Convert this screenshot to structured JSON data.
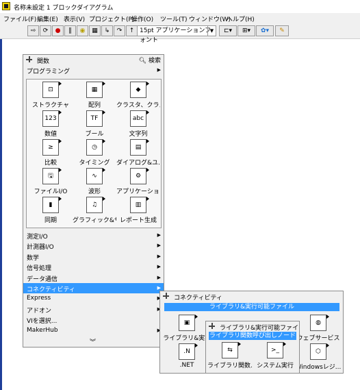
{
  "window": {
    "title": "名称未設定 1 ブロックダイアグラム"
  },
  "menubar": {
    "items": [
      "ファイル(F)",
      "編集(E)",
      "表示(V)",
      "プロジェクト(P)",
      "操作(O)",
      "ツール(T)",
      "ウィンドウ(W)",
      "ヘルプ(H)"
    ]
  },
  "toolbar": {
    "font_select": "15pt アプリケーションフォント"
  },
  "palette_main": {
    "title": "関数",
    "search_label": "検索",
    "top_category": "プログラミング",
    "tiles": [
      {
        "label": "ストラクチャ",
        "icon": "structures-icon"
      },
      {
        "label": "配列",
        "icon": "array-icon"
      },
      {
        "label": "クラスタ、クラス...",
        "icon": "cluster-icon"
      },
      {
        "label": "数値",
        "icon": "numeric-icon"
      },
      {
        "label": "ブール",
        "icon": "boolean-icon"
      },
      {
        "label": "文字列",
        "icon": "string-icon"
      },
      {
        "label": "比較",
        "icon": "comparison-icon"
      },
      {
        "label": "タイミング",
        "icon": "timing-icon"
      },
      {
        "label": "ダイアログ&ユ...",
        "icon": "dialog-icon"
      },
      {
        "label": "ファイルI/O",
        "icon": "file-io-icon"
      },
      {
        "label": "波形",
        "icon": "waveform-icon"
      },
      {
        "label": "アプリケーション...",
        "icon": "app-control-icon"
      },
      {
        "label": "同期",
        "icon": "synchronization-icon"
      },
      {
        "label": "グラフィック&サ...",
        "icon": "graphics-sound-icon"
      },
      {
        "label": "レポート生成",
        "icon": "report-icon"
      }
    ],
    "categories": [
      {
        "label": "測定I/O",
        "has_arrow": true
      },
      {
        "label": "計測器I/O",
        "has_arrow": true
      },
      {
        "label": "数学",
        "has_arrow": true
      },
      {
        "label": "信号処理",
        "has_arrow": true
      },
      {
        "label": "データ通信",
        "has_arrow": true
      },
      {
        "label": "コネクティビティ",
        "has_arrow": true,
        "selected": true
      },
      {
        "label": "Express",
        "has_arrow": true
      },
      {
        "label": "アドオン",
        "has_arrow": true
      },
      {
        "label": "VIを選択...",
        "has_arrow": false
      },
      {
        "label": "MakerHub",
        "has_arrow": true
      }
    ]
  },
  "palette_connectivity": {
    "title": "コネクティビティ",
    "highlight": "ライブラリ&実行可能ファイル",
    "tiles": [
      {
        "label": "ライブラリ&実...",
        "icon": "library-exec-icon"
      },
      {
        "label": ".NET",
        "icon": "dotnet-icon"
      },
      {
        "label": "ウェブサービス",
        "icon": "web-services-icon"
      },
      {
        "label": "Windowsレジ...",
        "icon": "windows-registry-icon"
      }
    ]
  },
  "palette_library": {
    "title": "ライブラリ&実行可能ファイル",
    "highlight": "ライブラリ関数呼び出しノード",
    "tiles": [
      {
        "label": "ライブラリ関数...",
        "icon": "call-library-icon"
      },
      {
        "label": "システム実行",
        "icon": "system-exec-icon"
      }
    ]
  },
  "colors": {
    "selection": "#3399ff",
    "palette_bg": "#f0f0f0",
    "edge_blue": "#1f3f99"
  }
}
